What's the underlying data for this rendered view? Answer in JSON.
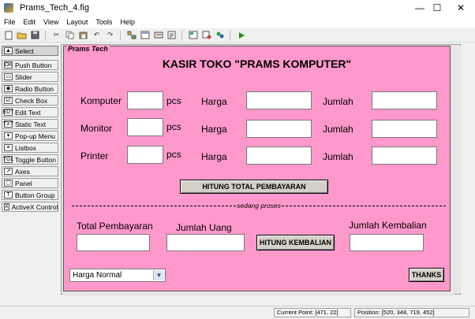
{
  "window": {
    "title": "Prams_Tech_4.fig",
    "minimize": "—",
    "maximize": "☐",
    "close": "✕"
  },
  "menu": [
    "File",
    "Edit",
    "View",
    "Layout",
    "Tools",
    "Help"
  ],
  "toolbar_icons": [
    "new-icon",
    "open-icon",
    "save-icon",
    "cut-icon",
    "copy-icon",
    "paste-icon",
    "undo-icon",
    "redo-icon",
    "align-icon",
    "menu-editor-icon",
    "tab-order-icon",
    "mfile-editor-icon",
    "property-inspector-icon",
    "object-browser-icon",
    "run-icon"
  ],
  "palette": [
    {
      "label": "Select",
      "icon": "▲"
    },
    {
      "label": "Push Button",
      "icon": "OK"
    },
    {
      "label": "Slider",
      "icon": "▭"
    },
    {
      "label": "Radio Button",
      "icon": "◉"
    },
    {
      "label": "Check Box",
      "icon": "☑"
    },
    {
      "label": "Edit Text",
      "icon": "EDT"
    },
    {
      "label": "Static Text",
      "icon": "TXT"
    },
    {
      "label": "Pop-up Menu",
      "icon": "▾"
    },
    {
      "label": "Listbox",
      "icon": "≡"
    },
    {
      "label": "Toggle Button",
      "icon": "TGL"
    },
    {
      "label": "Axes",
      "icon": "↗"
    },
    {
      "label": "Panel",
      "icon": "▢"
    },
    {
      "label": "Button Group",
      "icon": "T"
    },
    {
      "label": "ActiveX Control",
      "icon": "X"
    }
  ],
  "panel": {
    "title": "Prams Tech",
    "heading": "KASIR TOKO \"PRAMS KOMPUTER\"",
    "rows": [
      {
        "item": "Komputer",
        "unit": "pcs",
        "price_label": "Harga",
        "total_label": "Jumlah",
        "qty": "",
        "price": "",
        "total": ""
      },
      {
        "item": "Monitor",
        "unit": "pcs",
        "price_label": "Harga",
        "total_label": "Jumlah",
        "qty": "",
        "price": "",
        "total": ""
      },
      {
        "item": "Printer",
        "unit": "pcs",
        "price_label": "Harga",
        "total_label": "Jumlah",
        "qty": "",
        "price": "",
        "total": ""
      }
    ],
    "calc_total_button": "HITUNG TOTAL PEMBAYARAN",
    "divider_text": "sedang proses",
    "total_payment_label": "Total Pembayaran",
    "money_label": "Jumlah Uang",
    "calc_change_button": "HITUNG KEMBALIAN",
    "change_label": "Jumlah Kembalian",
    "total_payment_value": "",
    "money_value": "",
    "change_value": "",
    "popup_selected": "Harga Normal",
    "thanks_button": "THANKS"
  },
  "status": {
    "current_point": "Current Point:  [471, 22]",
    "position": "Position:  [520, 348, 719, 452]"
  }
}
